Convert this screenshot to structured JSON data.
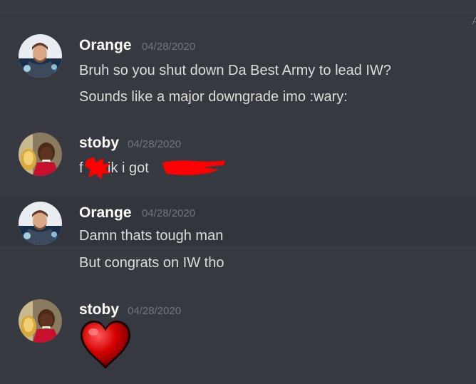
{
  "channel": {
    "divider_label": "A"
  },
  "messages": [
    {
      "author": "Orange",
      "timestamp": "04/28/2020",
      "avatar_icon": "thor-avatar",
      "lines": [
        "Bruh so you shut down Da Best Army to lead IW?",
        "Sounds like a major downgrade imo :wary:"
      ]
    },
    {
      "author": "stoby",
      "timestamp": "04/28/2020",
      "avatar_icon": "jordan-trophy-avatar",
      "lines": [
        "ik i got"
      ],
      "prefix": "f",
      "redacted": true
    },
    {
      "author": "Orange",
      "timestamp": "04/28/2020",
      "avatar_icon": "thor-avatar",
      "lines": [
        "Damn thats tough man",
        "But congrats on IW tho"
      ]
    },
    {
      "author": "stoby",
      "timestamp": "04/28/2020",
      "avatar_icon": "jordan-trophy-avatar",
      "emoji": "heart-icon"
    }
  ],
  "colors": {
    "background": "#36393f",
    "highlight": "#32353b",
    "username": "#ffffff",
    "timestamp": "#72767d",
    "redaction": "#ff0000",
    "heart": "#d40000"
  }
}
